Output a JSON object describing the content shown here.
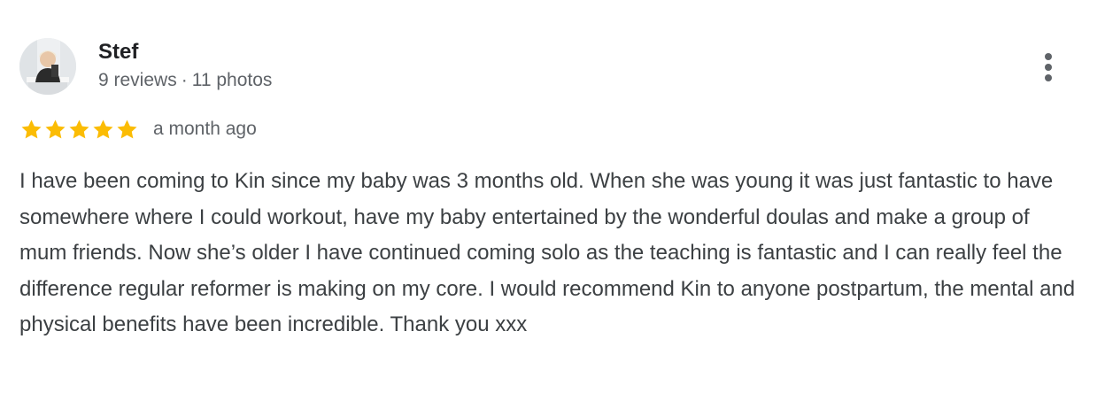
{
  "reviewer": {
    "name": "Stef",
    "review_count": "9 reviews",
    "separator": "·",
    "photo_count": "11 photos"
  },
  "rating": {
    "value": 5,
    "max": 5,
    "star_color": "#fbbc04",
    "date": "a month ago"
  },
  "review": {
    "text": "I have been coming to Kin since my baby was 3 months old. When she was young it was just fantastic to have somewhere where I could workout, have my baby entertained by the wonderful doulas and make a group of mum friends. Now she’s older I have continued coming solo as the teaching is fantastic and I can really feel the difference regular reformer is making on my core. I would recommend Kin to anyone postpartum, the mental and physical benefits have been incredible. Thank you xxx"
  },
  "actions": {
    "more_icon": "more-vert-icon"
  }
}
